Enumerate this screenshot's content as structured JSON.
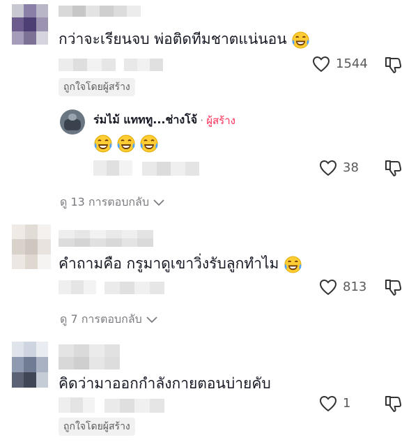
{
  "comments": [
    {
      "text": "กว่าจะเรียนจบ พ่อติดทีมชาตแน่นอน",
      "likes": "1544",
      "creator_liked": "ถูกใจโดยผู้สร้าง",
      "reply": {
        "author": "ร่มไม้ แทททู...ช่างโจ้",
        "creator_label": "ผู้สร้าง",
        "likes": "38"
      },
      "view_replies": "ดู 13 การตอบกลับ"
    },
    {
      "text": "คำถามคือ กรูมาดูเขาวิ่งรับลูกทำไม",
      "likes": "813",
      "view_replies": "ดู 7 การตอบกลับ"
    },
    {
      "text": "คิดว่ามาออกกำลังกายตอนบ่ายคับ",
      "likes": "1",
      "creator_liked": "ถูกใจโดยผู้สร้าง"
    }
  ],
  "icons": {
    "like": "heart-outline-icon",
    "dislike": "thumbs-down-icon",
    "emoji": "laughing-tears-emoji",
    "expand": "chevron-down-icon"
  },
  "colors": {
    "creator_accent": "#fe2c55",
    "text": "#161823",
    "muted": "#7a7b80"
  }
}
